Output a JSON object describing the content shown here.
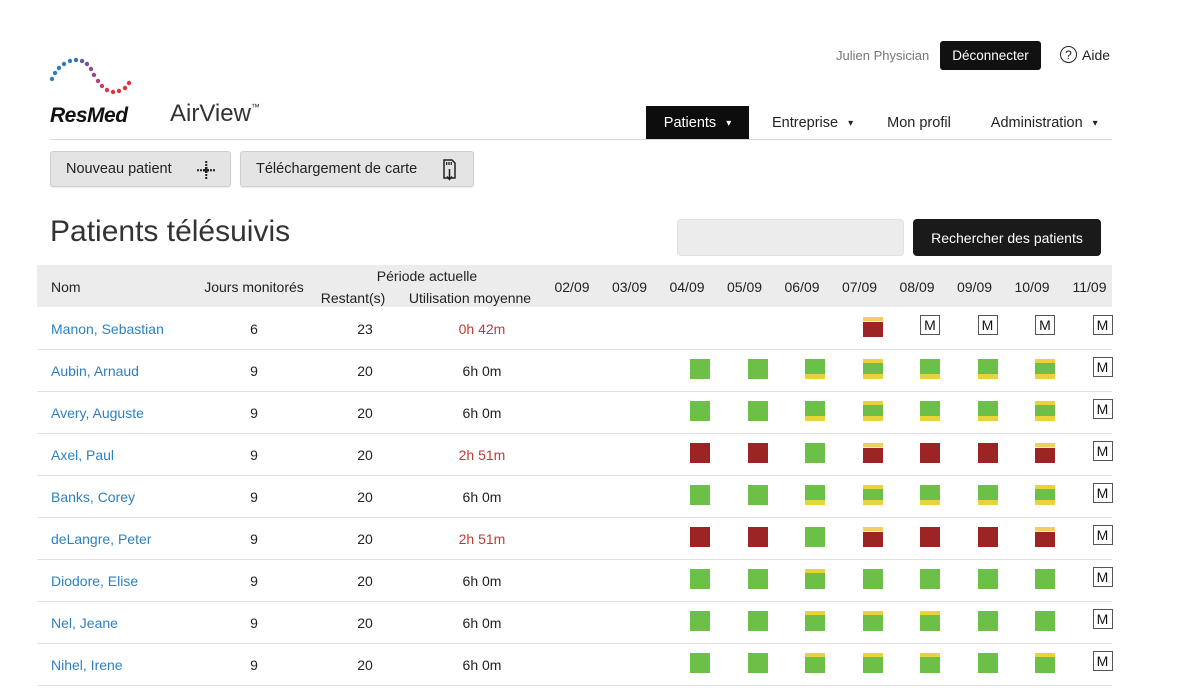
{
  "brand": {
    "name": "ResMed",
    "product": "AirView",
    "trademark": "™"
  },
  "user": {
    "name": "Julien Physician",
    "logout_label": "Déconnecter",
    "help_label": "Aide"
  },
  "nav": {
    "patients": "Patients",
    "entreprise": "Entreprise",
    "profil": "Mon profil",
    "administration": "Administration"
  },
  "toolbar": {
    "new_patient": "Nouveau patient",
    "card_download": "Téléchargement de carte"
  },
  "page_title": "Patients télésuivis",
  "search": {
    "value": "",
    "placeholder": "",
    "button_label": "Rechercher des patients"
  },
  "table": {
    "headers": {
      "name": "Nom",
      "days": "Jours monitorés",
      "period": "Période actuelle",
      "remaining": "Restant(s)",
      "usage": "Utilisation moyenne"
    },
    "dates": [
      "02/09",
      "03/09",
      "04/09",
      "05/09",
      "06/09",
      "07/09",
      "08/09",
      "09/09",
      "10/09",
      "11/09"
    ],
    "legend_colors": {
      "compliant": "#6cbf47",
      "noncompliant": "#9c2424",
      "warning": "#e8d33b"
    },
    "rows": [
      {
        "name": "Manon, Sebastian",
        "days": "6",
        "remaining": "23",
        "usage": "0h 42m",
        "usage_low": true,
        "days_status": [
          "",
          "",
          "",
          "",
          "",
          "red-t",
          "m",
          "m",
          "m",
          "m"
        ]
      },
      {
        "name": "Aubin, Arnaud",
        "days": "9",
        "remaining": "20",
        "usage": "6h 0m",
        "usage_low": false,
        "days_status": [
          "",
          "",
          "green",
          "green",
          "green-y",
          "green-ty",
          "green-y",
          "green-y",
          "green-ty",
          "m"
        ]
      },
      {
        "name": "Avery, Auguste",
        "days": "9",
        "remaining": "20",
        "usage": "6h 0m",
        "usage_low": false,
        "days_status": [
          "",
          "",
          "green",
          "green",
          "green-y",
          "green-ty",
          "green-y",
          "green-y",
          "green-ty",
          "m"
        ]
      },
      {
        "name": "Axel, Paul",
        "days": "9",
        "remaining": "20",
        "usage": "2h 51m",
        "usage_low": true,
        "days_status": [
          "",
          "",
          "red",
          "red",
          "green",
          "red-t",
          "red",
          "red",
          "red-t",
          "m"
        ]
      },
      {
        "name": "Banks, Corey",
        "days": "9",
        "remaining": "20",
        "usage": "6h 0m",
        "usage_low": false,
        "days_status": [
          "",
          "",
          "green",
          "green",
          "green-y",
          "green-ty",
          "green-y",
          "green-y",
          "green-ty",
          "m"
        ]
      },
      {
        "name": "deLangre, Peter",
        "days": "9",
        "remaining": "20",
        "usage": "2h 51m",
        "usage_low": true,
        "days_status": [
          "",
          "",
          "red",
          "red",
          "green",
          "red-t",
          "red",
          "red",
          "red-t",
          "m"
        ]
      },
      {
        "name": "Diodore, Elise",
        "days": "9",
        "remaining": "20",
        "usage": "6h 0m",
        "usage_low": false,
        "days_status": [
          "",
          "",
          "green",
          "green",
          "green-t",
          "green",
          "green",
          "green",
          "green",
          "m"
        ]
      },
      {
        "name": "Nel, Jeane",
        "days": "9",
        "remaining": "20",
        "usage": "6h 0m",
        "usage_low": false,
        "days_status": [
          "",
          "",
          "green",
          "green",
          "green-t",
          "green-t",
          "green-t",
          "green",
          "green",
          "m"
        ]
      },
      {
        "name": "Nihel, Irene",
        "days": "9",
        "remaining": "20",
        "usage": "6h 0m",
        "usage_low": false,
        "days_status": [
          "",
          "",
          "green",
          "green",
          "green-t",
          "green-t",
          "green-t",
          "green",
          "green-t",
          "m"
        ]
      }
    ],
    "manual_marker": "M"
  }
}
